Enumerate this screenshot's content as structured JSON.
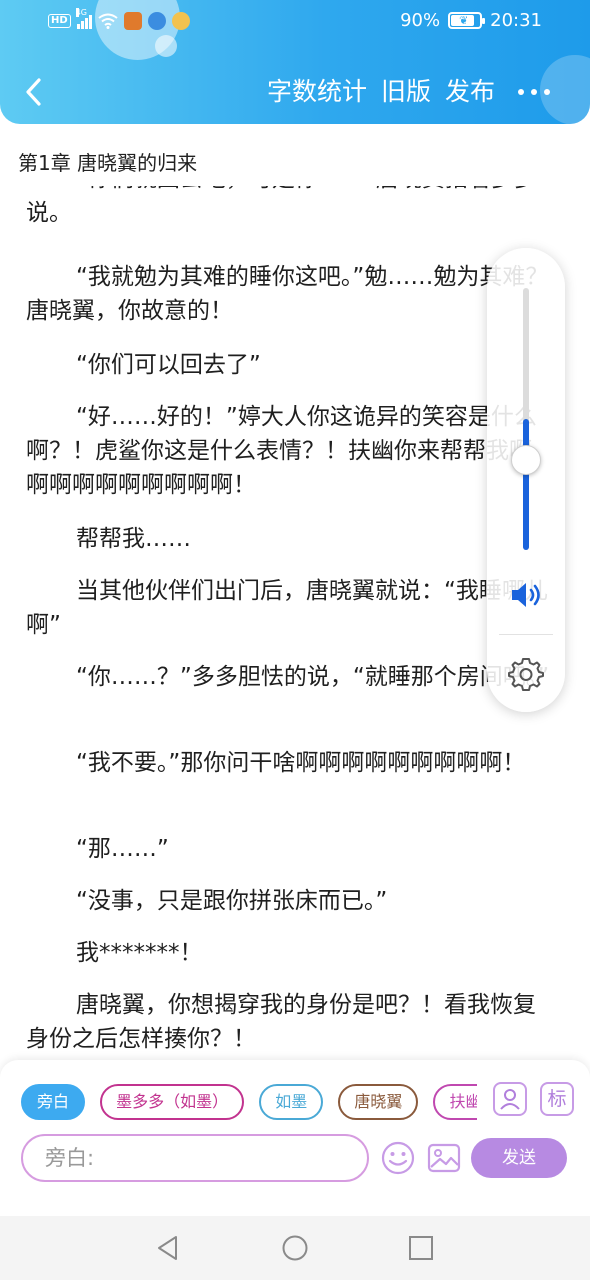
{
  "status_bar": {
    "hd": "HD",
    "network": "4G",
    "battery_text": "90%",
    "battery_level": 0.9,
    "time": "20:31"
  },
  "toolbar": {
    "back_icon": "chevron-left-icon",
    "word_count_label": "字数统计",
    "old_version_label": "旧版",
    "publish_label": "发布",
    "more_icon": "more-dots-icon"
  },
  "chapter": {
    "title": "第1章  唐晓翼的归来"
  },
  "story": {
    "paragraphs": [
      "“你们就回去吧，可是你……”唐晓翼指着多多说。",
      "“我就勉为其难的睡你这吧。”勉……勉为其难？唐晓翼，你故意的！",
      "“你们可以回去了”",
      "“好……好的！”婷大人你这诡异的笑容是什么啊？！虎鲨你这是什么表情？！扶幽你来帮帮我啊啊啊啊啊啊啊啊啊啊！",
      "帮帮我……",
      "当其他伙伴们出门后，唐晓翼就说：“我睡哪儿啊”",
      "“你……？”多多胆怯的说，“就睡那个房间吧。”",
      "“我不要。”那你问干啥啊啊啊啊啊啊啊啊啊！",
      "“那……”",
      "“没事，只是跟你拼张床而已。”",
      "我*******！",
      "唐晓翼，你想揭穿我的身份是吧？！看我恢复身份之后怎样揍你？！"
    ]
  },
  "volume_panel": {
    "level": 0.5,
    "accent_color": "#1a63dc",
    "speaker_icon": "speaker-icon",
    "settings_icon": "gear-icon"
  },
  "composer": {
    "roles": [
      {
        "label": "旁白",
        "active": true
      },
      {
        "label": "墨多多（如墨）",
        "active": false
      },
      {
        "label": "如墨",
        "active": false
      },
      {
        "label": "唐晓翼",
        "active": false
      },
      {
        "label": "扶幽",
        "active": false
      }
    ],
    "person_icon": "person-icon",
    "mark_label": "标",
    "input_placeholder": "旁白:",
    "emoji_icon": "smile-icon",
    "image_icon": "image-icon",
    "send_label": "发送"
  },
  "system_nav": {
    "back": "triangle-back-icon",
    "home": "circle-home-icon",
    "recents": "square-recents-icon"
  }
}
